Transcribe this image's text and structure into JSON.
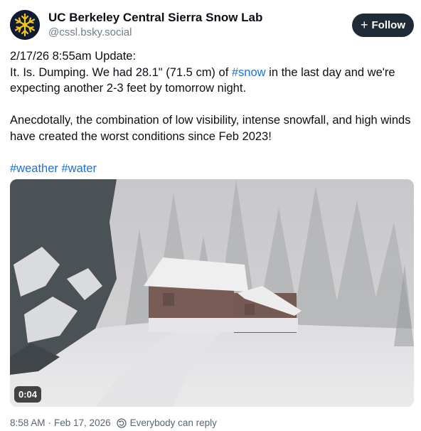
{
  "author": {
    "display_name": "UC Berkeley Central Sierra Snow Lab",
    "handle": "@cssl.bsky.social",
    "avatar_icon": "snowflake-icon"
  },
  "follow_button": {
    "icon": "plus-icon",
    "label": "Follow"
  },
  "post": {
    "line1": "2/17/26 8:55am Update:",
    "line2_before": "It. Is. Dumping. We had 28.1\" (71.5 cm) of ",
    "line2_tag": "#snow",
    "line2_after": " in the last day and we're expecting another 2-3 feet by tomorrow night.",
    "para2": "Anecdotally, the combination of low visibility, intense snowfall, and high winds have created the worst conditions since Feb 2023!",
    "tags": [
      "#weather",
      "#water"
    ]
  },
  "video": {
    "duration": "0:04"
  },
  "footer": {
    "time": "8:58 AM",
    "separator": "·",
    "date": "Feb 17, 2026",
    "reply_icon": "reply-settings-icon",
    "reply_setting": "Everybody can reply"
  },
  "colors": {
    "link": "#1a73d6",
    "follow_bg": "#1f2a37",
    "avatar_bg": "#0d1b33",
    "snowflake": "#f2c21b"
  }
}
